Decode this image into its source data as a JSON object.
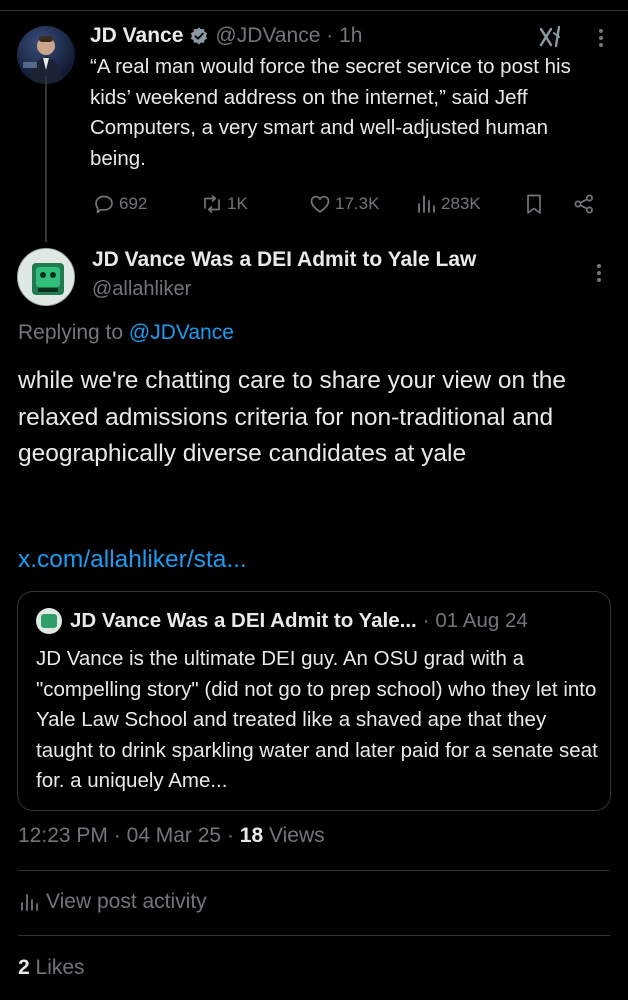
{
  "parent_tweet": {
    "name": "JD Vance",
    "handle": "@JDVance",
    "time": "1h",
    "text": "“A real man would force the secret service to post his kids’ weekend address on the internet,” said Jeff Computers, a very smart and well-adjusted human being.",
    "stats": {
      "replies": "692",
      "reposts": "1K",
      "likes": "17.3K",
      "views": "283K"
    }
  },
  "main_tweet": {
    "name": "JD Vance Was a DEI Admit to Yale Law",
    "handle": "@allahliker",
    "replying_prefix": "Replying to",
    "replying_to": "@JDVance",
    "text": "while we're chatting care to share your view on the relaxed admissions criteria for non-traditional and geographically diverse candidates at yale",
    "link": "x.com/allahliker/sta..."
  },
  "quoted_tweet": {
    "name": "JD Vance Was a DEI Admit to Yale...",
    "date": "01 Aug 24",
    "text": "JD Vance is the ultimate DEI guy. An OSU grad with a \"compelling story\" (did not go to prep school) who they let into Yale Law School and treated like a shaved ape that they taught to drink sparkling water and later paid for a senate seat for. a uniquely Ame..."
  },
  "meta": {
    "time": "12:23 PM",
    "date": "04 Mar 25",
    "views_count": "18",
    "views_label": "Views"
  },
  "activity": {
    "label": "View post activity"
  },
  "likes": {
    "count": "2",
    "label": "Likes"
  },
  "colors": {
    "background": "#000000",
    "text": "#e7e9ea",
    "muted": "#71767b",
    "accent": "#1d9bf0",
    "border": "#2f3336"
  }
}
